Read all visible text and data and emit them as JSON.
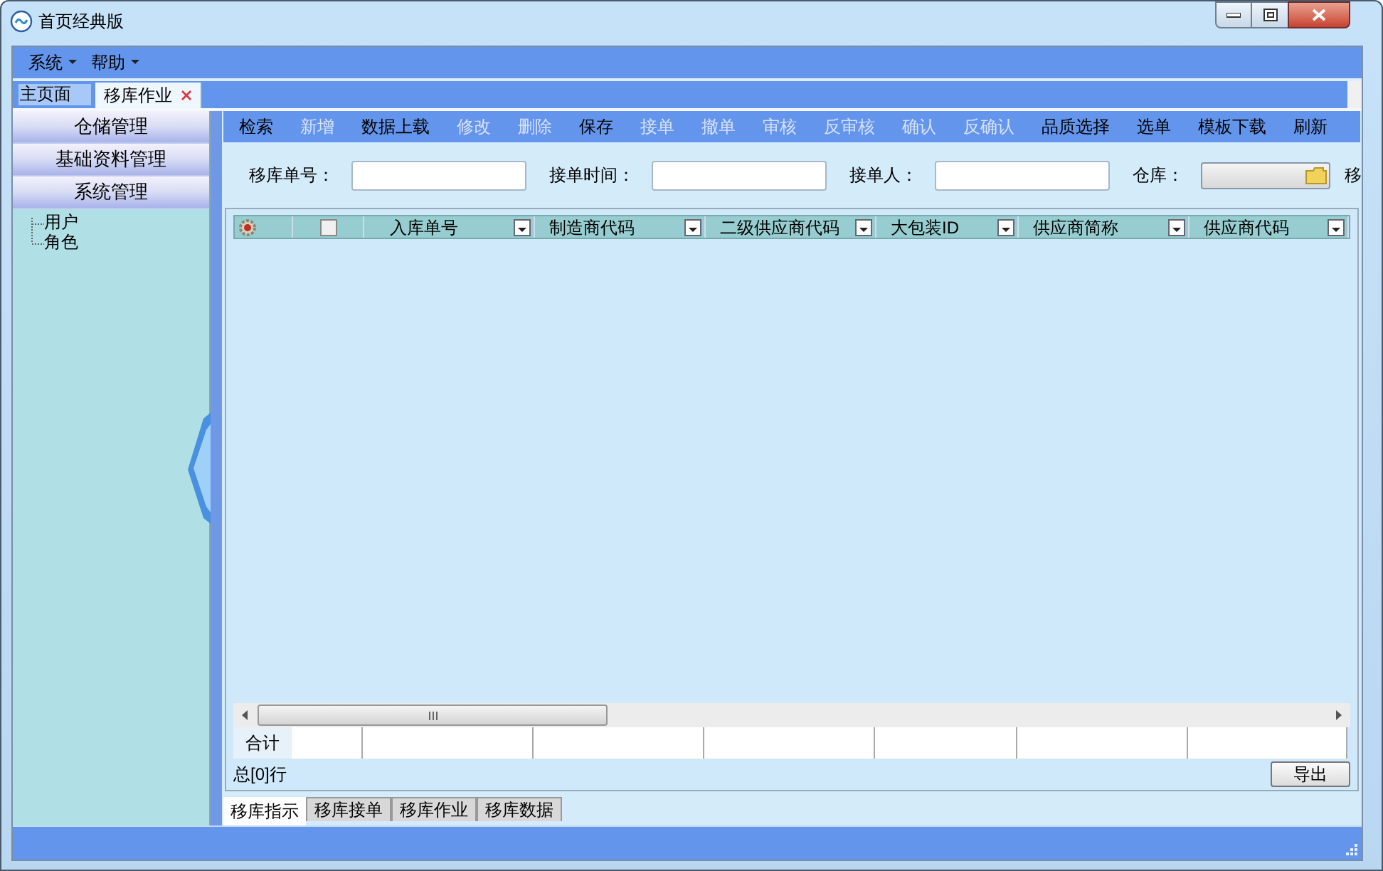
{
  "window": {
    "title": "首页经典版"
  },
  "menu": [
    {
      "label": "系统"
    },
    {
      "label": "帮助"
    }
  ],
  "page_tabs": [
    {
      "label": "主页面",
      "selected": false,
      "closable": false
    },
    {
      "label": "移库作业",
      "selected": true,
      "closable": true
    }
  ],
  "sidebar": {
    "sections": [
      {
        "label": "仓储管理"
      },
      {
        "label": "基础资料管理"
      },
      {
        "label": "系统管理",
        "children": [
          {
            "label": "用户"
          },
          {
            "label": "角色"
          }
        ]
      }
    ]
  },
  "toolbar": [
    {
      "label": "检索",
      "disabled": false
    },
    {
      "label": "新增",
      "disabled": true
    },
    {
      "label": "数据上载",
      "disabled": false
    },
    {
      "label": "修改",
      "disabled": true
    },
    {
      "label": "删除",
      "disabled": true
    },
    {
      "label": "保存",
      "disabled": false
    },
    {
      "label": "接单",
      "disabled": true
    },
    {
      "label": "撤单",
      "disabled": true
    },
    {
      "label": "审核",
      "disabled": true
    },
    {
      "label": "反审核",
      "disabled": true
    },
    {
      "label": "确认",
      "disabled": true
    },
    {
      "label": "反确认",
      "disabled": true
    },
    {
      "label": "品质选择",
      "disabled": false
    },
    {
      "label": "选单",
      "disabled": false
    },
    {
      "label": "模板下载",
      "disabled": false
    },
    {
      "label": "刷新",
      "disabled": false
    }
  ],
  "filters": [
    {
      "label": "移库单号：",
      "kind": "text"
    },
    {
      "label": "接单时间：",
      "kind": "text"
    },
    {
      "label": "接单人：",
      "kind": "text"
    },
    {
      "label": "仓库：",
      "kind": "combo"
    },
    {
      "label": "移",
      "kind": "cut"
    }
  ],
  "grid": {
    "select_all_checked": false,
    "columns": [
      "入库单号",
      "制造商代码",
      "二级供应商代码",
      "大包装ID",
      "供应商简称",
      "供应商代码"
    ],
    "sum_label": "合计",
    "row_count": "总[0]行"
  },
  "export_button": "导出",
  "bottom_tabs": [
    {
      "label": "移库指示",
      "selected": true
    },
    {
      "label": "移库接单",
      "selected": false
    },
    {
      "label": "移库作业",
      "selected": false
    },
    {
      "label": "移库数据",
      "selected": false
    }
  ]
}
